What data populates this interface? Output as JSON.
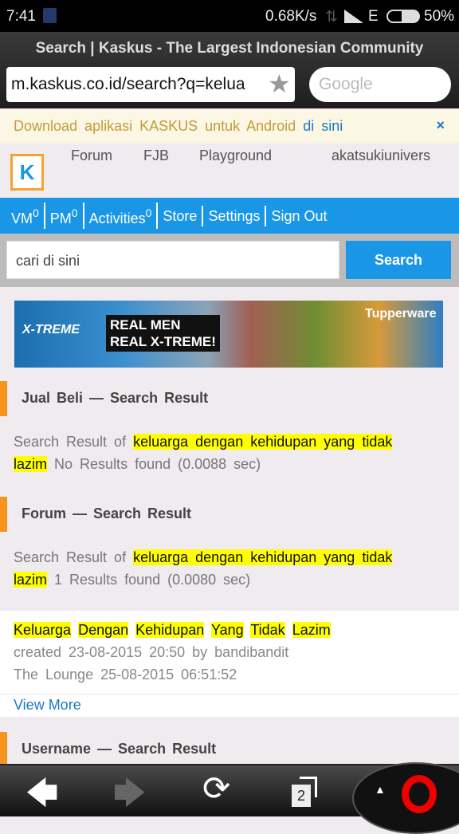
{
  "status": {
    "time": "7:41",
    "speed": "0.68K/s",
    "network": "E",
    "battery": "50%"
  },
  "browser": {
    "title": "Search | Kaskus - The Largest Indonesian Community",
    "url": "m.kaskus.co.id/search?q=kelua",
    "search_placeholder": "Google",
    "tab_count": "2"
  },
  "promo": {
    "text": "Download aplikasi KASKUS untuk Android",
    "link": "di sini",
    "close": "×"
  },
  "nav": {
    "items": [
      "Forum",
      "FJB",
      "Playground"
    ],
    "user": "akatsukiunivers"
  },
  "bluebar": {
    "vm": "VM",
    "vm_count": "0",
    "pm": "PM",
    "pm_count": "0",
    "activities": "Activities",
    "activities_count": "0",
    "store": "Store",
    "settings": "Settings",
    "signout": "Sign Out"
  },
  "search": {
    "placeholder": "cari di sini",
    "button": "Search"
  },
  "ad": {
    "text1": "REAL MEN",
    "text2": "REAL X-TREME!",
    "brand": "Tupperware",
    "logo": "X-TREME"
  },
  "sections": [
    {
      "title": "Jual Beli — Search Result",
      "prefix": "Search Result of",
      "query": "keluarga dengan kehidupan yang tidak lazim",
      "suffix": "No Results found (0.0088 sec)"
    },
    {
      "title": "Forum — Search Result",
      "prefix": "Search Result of",
      "query": "keluarga dengan kehidupan yang tidak lazim",
      "suffix": "1 Results found (0.0080 sec)"
    },
    {
      "title": "Username — Search Result"
    }
  ],
  "result": {
    "title_words": [
      "Keluarga",
      "Dengan",
      "Kehidupan",
      "Yang",
      "Tidak",
      "Lazim"
    ],
    "created": "created 23-08-2015 20:50 by bandibandit",
    "forum": "The Lounge 25-08-2015 06:51:52",
    "view_more": "View More"
  }
}
